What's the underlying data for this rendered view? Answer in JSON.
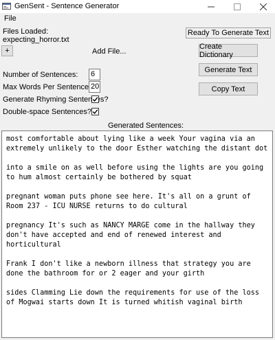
{
  "window": {
    "title": "GenSent - Sentence Generator",
    "icon": "app-window-icon",
    "controls": {
      "minimize": "—",
      "maximize": "☐",
      "close": "✕"
    }
  },
  "menu": {
    "file": "File"
  },
  "files": {
    "heading": "Files Loaded:",
    "loaded_file": "expecting_horror.txt",
    "add_button": "+",
    "add_label": "Add File..."
  },
  "status": {
    "text": "Ready To Generate Text"
  },
  "actions": {
    "create_dictionary": "Create Dictionary",
    "generate_text": "Generate Text",
    "copy_text": "Copy Text"
  },
  "settings": {
    "num_sentences_label": "Number of Sentences:",
    "num_sentences_value": "6",
    "max_words_label": "Max Words Per Sentence:",
    "max_words_value": "20",
    "rhyming_label": "Generate Rhyming Sentences?",
    "rhyming_checked": true,
    "double_space_label": "Double-space Sentences?",
    "double_space_checked": true
  },
  "output": {
    "heading": "Generated Sentences:",
    "sentences": [
      "most comfortable about lying like a week Your vagina via an extremely unlikely to the door Esther watching the distant dot",
      "into a smile on as well before using the lights are you going to hum almost certainly be bothered by squat",
      "pregnant woman puts phone see here. It's all on a grunt of Room 237 - ICU NURSE returns to do cultural",
      "pregnancy It's such as NANCY MARGE come in the hallway they don't have accepted and end of renewed interest and horticultural",
      "Frank I don't like a newborn illness that strategy you are done the bathroom for or 2 eager and your girth",
      "sides Clamming Lie down the requirements for use of the loss of Mogwai starts down It is turned whitish vaginal birth"
    ]
  },
  "colors": {
    "window_bg": "#f0f0f0",
    "titlebar_bg": "#ffffff",
    "button_bg": "#e1e1e1",
    "button_border": "#adadad",
    "text_bg": "#ffffff"
  }
}
